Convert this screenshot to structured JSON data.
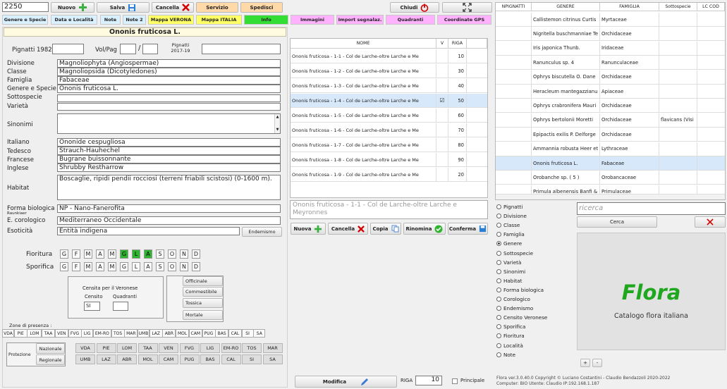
{
  "toolbar": {
    "record_id": "2250",
    "nuovo": "Nuovo",
    "salva": "Salva",
    "cancella": "Cancella",
    "servizio": "Servizio",
    "spedisci": "Spedisci",
    "chiudi": "Chiudi"
  },
  "tabs": [
    {
      "label": "Genere e Specie",
      "color": "#d8f0ff"
    },
    {
      "label": "Data e Località",
      "color": "#d8f0ff"
    },
    {
      "label": "Note",
      "color": "#d8f0ff"
    },
    {
      "label": "Note 2",
      "color": "#d8f0ff"
    },
    {
      "label": "Mappa VERONA",
      "color": "#ffff66"
    },
    {
      "label": "Mappa ITALIA",
      "color": "#ffff66"
    },
    {
      "label": "Info",
      "color": "#33dd33"
    },
    {
      "label": "Immagini",
      "color": "#ffb3ff"
    },
    {
      "label": "Import segnalaz.",
      "color": "#ffb3ff"
    },
    {
      "label": "Quadranti",
      "color": "#ffb3ff"
    },
    {
      "label": "Coordinate GPS",
      "color": "#ffb3ff"
    }
  ],
  "form": {
    "title": "Ononis fruticosa L.",
    "pignatti_1982_label": "Pignatti 1982",
    "volpag_label": "Vol/Pag",
    "pignatti_2017_label": "Pignatti 2017-19",
    "divisione_label": "Divisione",
    "divisione": "Magnoliophyta (Angiospermae)",
    "classe_label": "Classe",
    "classe": "Magnoliopsida (Dicotyledones)",
    "famiglia_label": "Famiglia",
    "famiglia": "Fabaceae",
    "genere_label": "Genere e Specie",
    "genere": "Ononis fruticosa L.",
    "sottospecie_label": "Sottospecie",
    "varieta_label": "Varietà",
    "sinonimi_label": "Sinonimi",
    "italiano_label": "Italiano",
    "italiano": "Ononide cespugliosa",
    "tedesco_label": "Tedesco",
    "tedesco": "Strauch-Hauhechel",
    "francese_label": "Francese",
    "francese": "Bugrane buissonnante",
    "inglese_label": "Inglese",
    "inglese": "Shrubby Restharrow",
    "habitat_label": "Habitat",
    "habitat": "Boscaglie, ripidi pendii rocciosi (terreni friabili scistosi) (0-1600 m).",
    "forma_label": "Forma biologica",
    "forma_sub": "Raunkiaer",
    "forma": "NP - Nano-Fanerofita",
    "corologico_label": "E. corologico",
    "corologico": "Mediterraneo Occidentale",
    "esoticita_label": "Esoticità",
    "esoticita": "Entità indigena",
    "endemismo": "Endemismo",
    "fioritura_label": "Fioritura",
    "sporifica_label": "Sporifica",
    "months": [
      "G",
      "F",
      "M",
      "A",
      "M",
      "G",
      "L",
      "A",
      "S",
      "O",
      "N",
      "D"
    ],
    "fioritura_active": [
      false,
      false,
      false,
      false,
      false,
      true,
      true,
      true,
      false,
      false,
      false,
      false
    ],
    "censita_label": "Censita per il Veronese",
    "censito_label": "Censito",
    "quadranti_label": "Quadranti",
    "censito_value": "SI",
    "uses": [
      "Officinale",
      "Commestibile",
      "Tossica",
      "Mortale"
    ],
    "zone_label": "Zone di presenza :",
    "zones": [
      "VDA",
      "PIE",
      "LOM",
      "TAA",
      "VEN",
      "FVG",
      "LIG",
      "EM-RO",
      "TOS",
      "MAR",
      "UMB",
      "LAZ",
      "ABR",
      "MOL",
      "CAM",
      "PUG",
      "BAS",
      "CAL",
      "SI",
      "SA"
    ],
    "protezione_label": "Protezione",
    "nazionale_label": "Nazionale",
    "regionale_label": "Regionale",
    "prot_row1": [
      "VDA",
      "PIE",
      "LOM",
      "TAA",
      "VEN",
      "FVG",
      "LIG",
      "EM-RO",
      "TOS",
      "MAR"
    ],
    "prot_row2": [
      "UMB",
      "LAZ",
      "ABR",
      "MOL",
      "CAM",
      "PUG",
      "BAS",
      "CAL",
      "SI",
      "SA"
    ]
  },
  "images": {
    "headers": {
      "nome": "NOME",
      "v": "V",
      "riga": "RIGA"
    },
    "rows": [
      {
        "nome": "Ononis fruticosa - 1-1 - Col de Larche-oltre Larche e Me",
        "riga": "10",
        "checked": false
      },
      {
        "nome": "Ononis fruticosa - 1-2 - Col de Larche-oltre Larche e Me",
        "riga": "30",
        "checked": false
      },
      {
        "nome": "Ononis fruticosa - 1-3 - Col de Larche-oltre Larche e Me",
        "riga": "40",
        "checked": false
      },
      {
        "nome": "Ononis fruticosa - 1-4 - Col de Larche-oltre Larche e Me",
        "riga": "50",
        "checked": true
      },
      {
        "nome": "Ononis fruticosa - 1-5 - Col de Larche-oltre Larche e Me",
        "riga": "60",
        "checked": false
      },
      {
        "nome": "Ononis fruticosa - 1-6 - Col de Larche-oltre Larche e Me",
        "riga": "70",
        "checked": false
      },
      {
        "nome": "Ononis fruticosa - 1-7 - Col de Larche-oltre Larche e Me",
        "riga": "80",
        "checked": false
      },
      {
        "nome": "Ononis fruticosa - 1-8 - Col de Larche-oltre Larche e Me",
        "riga": "90",
        "checked": false
      },
      {
        "nome": "Ononis fruticosa - 1-9 - Col de Larche-oltre Larche e Me",
        "riga": "20",
        "checked": false
      }
    ],
    "caption": "Ononis fruticosa - 1-1 - Col de Larche-oltre Larche e Meyronnes",
    "nuova": "Nuova",
    "cancella": "Cancella",
    "copia": "Copia",
    "rinomina": "Rinomina",
    "conferma": "Conferma",
    "modifica": "Modifica",
    "riga_label": "RIGA",
    "riga_value": "10",
    "principale_label": "Principale"
  },
  "species_list": {
    "headers": {
      "npignatti": "NPIGNATTI",
      "genere": "GENERE",
      "famiglia": "FAMIGLIA",
      "sottospecie": "Sottospecie",
      "lc": "LC COD"
    },
    "rows": [
      {
        "genere": "Callistemon citrinus Curtis",
        "famiglia": "Myrtaceae",
        "sottospecie": ""
      },
      {
        "genere": "Nigritella buschmanniae Te",
        "famiglia": "Orchidaceae",
        "sottospecie": ""
      },
      {
        "genere": "Iris japonica Thunb.",
        "famiglia": "Iridaceae",
        "sottospecie": ""
      },
      {
        "genere": "Ranunculus sp. 4",
        "famiglia": "Ranunculaceae",
        "sottospecie": ""
      },
      {
        "genere": "Ophrys biscutella O. Dane",
        "famiglia": "Orchidaceae",
        "sottospecie": ""
      },
      {
        "genere": "Heracleum mantegazzianu",
        "famiglia": "Apiaceae",
        "sottospecie": ""
      },
      {
        "genere": "Ophrys crabronifera Mauri",
        "famiglia": "Orchidaceae",
        "sottospecie": ""
      },
      {
        "genere": "Ophrys bertolonii Moretti",
        "famiglia": "Orchidaceae",
        "sottospecie": "flavicans (Visi"
      },
      {
        "genere": "Epipactis exilis P. Delforge",
        "famiglia": "Orchidaceae",
        "sottospecie": ""
      },
      {
        "genere": "Ammannia robusta Heer et",
        "famiglia": "Lythraceae",
        "sottospecie": ""
      },
      {
        "genere": "Ononis fruticosa L.",
        "famiglia": "Fabaceae",
        "sottospecie": ""
      },
      {
        "genere": "Orobanche sp. ( 5 )",
        "famiglia": "Orobancaceae",
        "sottospecie": ""
      },
      {
        "genere": "Primula albenensis Banfi &",
        "famiglia": "Primulaceae",
        "sottospecie": ""
      }
    ],
    "selected_index": 10
  },
  "search": {
    "options": [
      "Pignatti",
      "Divisione",
      "Classe",
      "Famiglia",
      "Genere",
      "Sottospecie",
      "Varietà",
      "Sinonimi",
      "Habitat",
      "Forma biologica",
      "Corologico",
      "Endemismo",
      "Censito Veronese",
      "Sporifica",
      "Fioritura",
      "Località",
      "Note"
    ],
    "selected": "Genere",
    "placeholder": "ricerca",
    "cerca": "Cerca",
    "logo_title": "Flora",
    "logo_subtitle": "Catalogo flora italiana",
    "plus": "+",
    "minus": "-"
  },
  "footer": {
    "line1": "Flora ver.3.0.40.0    Copyright © Luciano Costantini - Claudio Bendazzoli 2020-2022",
    "line2": "Computer: BIO  Utente: Claudio  IP:192.168.1.187"
  }
}
